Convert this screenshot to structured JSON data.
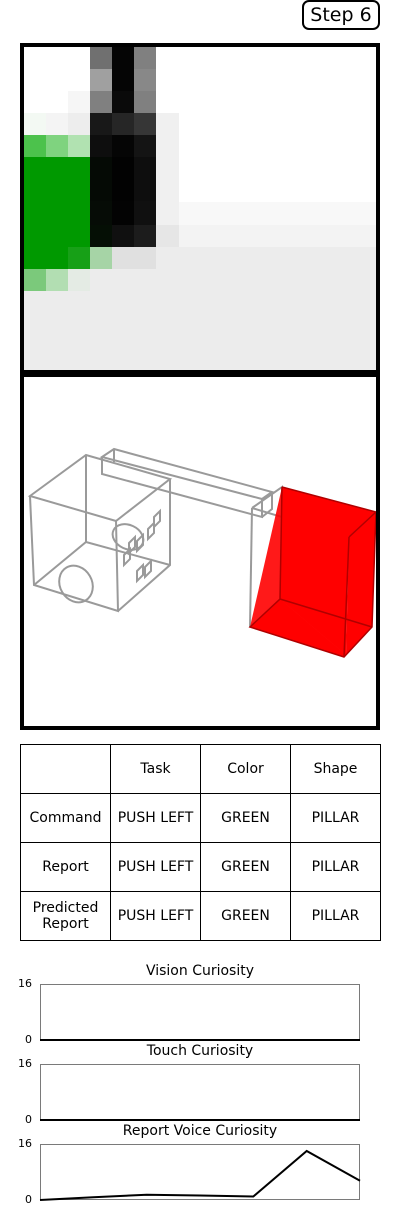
{
  "step_label": "Step 6",
  "colors": {
    "object_red": "#ff0000",
    "pixel_green": "#009900",
    "line_gray": "#9a9a9a"
  },
  "table": {
    "headers": [
      "",
      "Task",
      "Color",
      "Shape"
    ],
    "rows": [
      {
        "label": "Command",
        "task": "PUSH LEFT",
        "color": "GREEN",
        "shape": "PILLAR"
      },
      {
        "label": "Report",
        "task": "PUSH LEFT",
        "color": "GREEN",
        "shape": "PILLAR"
      },
      {
        "label": "Predicted Report",
        "task": "PUSH LEFT",
        "color": "GREEN",
        "shape": "PILLAR"
      }
    ]
  },
  "chart_data": [
    {
      "type": "line",
      "title": "Vision Curiosity",
      "ylim": [
        0,
        16
      ],
      "yticks": [
        "16",
        "0"
      ],
      "x": [
        0,
        1,
        2,
        3,
        4,
        5,
        6
      ],
      "values": [
        0,
        0,
        0,
        0,
        0,
        0,
        0
      ]
    },
    {
      "type": "line",
      "title": "Touch Curiosity",
      "ylim": [
        0,
        16
      ],
      "yticks": [
        "16",
        "0"
      ],
      "x": [
        0,
        1,
        2,
        3,
        4,
        5,
        6
      ],
      "values": [
        0,
        0,
        0,
        0,
        0,
        0,
        0
      ]
    },
    {
      "type": "line",
      "title": "Report Voice Curiosity",
      "ylim": [
        0,
        16
      ],
      "yticks": [
        "16",
        "0"
      ],
      "x": [
        0,
        1,
        2,
        3,
        4,
        5,
        6
      ],
      "values": [
        0,
        0.8,
        1.5,
        1.3,
        1.0,
        14.0,
        5.5
      ]
    }
  ]
}
